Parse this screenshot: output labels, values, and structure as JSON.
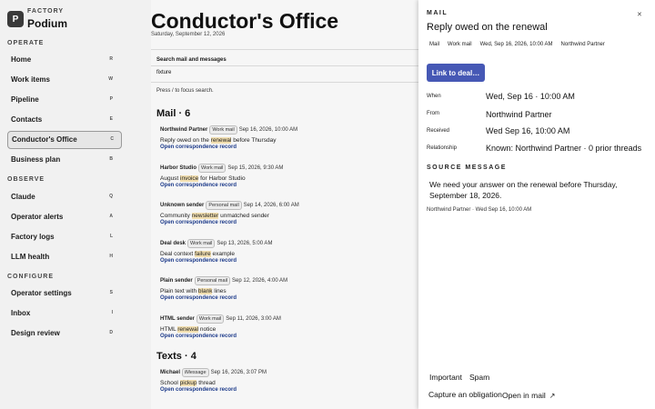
{
  "brand": {
    "logo_letter": "P",
    "kicker": "FACTORY",
    "name": "Podium"
  },
  "sidebar": {
    "sections": {
      "operate": "OPERATE",
      "observe": "OBSERVE",
      "configure": "CONFIGURE"
    },
    "items": [
      {
        "label": "Home",
        "key": "R"
      },
      {
        "label": "Work items",
        "key": "W"
      },
      {
        "label": "Pipeline",
        "key": "P"
      },
      {
        "label": "Contacts",
        "key": "E"
      },
      {
        "label": "Conductor's Office",
        "key": "C"
      },
      {
        "label": "Business plan",
        "key": "B"
      },
      {
        "label": "Claude",
        "key": "Q"
      },
      {
        "label": "Operator alerts",
        "key": "A"
      },
      {
        "label": "Factory logs",
        "key": "L"
      },
      {
        "label": "LLM health",
        "key": "H"
      },
      {
        "label": "Operator settings",
        "key": "S"
      },
      {
        "label": "Inbox",
        "key": "I"
      },
      {
        "label": "Design review",
        "key": "D"
      }
    ]
  },
  "main": {
    "title": "Conductor's Office",
    "date": "Saturday, September 12, 2026",
    "search_title": "Search mail and messages",
    "search_value": "fixture",
    "search_hint": "Press / to focus search.",
    "mail_heading": "Mail · 6",
    "texts_heading": "Texts · 4",
    "open_link": "Open correspondence record",
    "messages": [
      {
        "sender": "Northwind Partner",
        "pill": "Work mail",
        "meta": "Sep 16, 2026, 10:00 AM",
        "pre": "Reply owed on the ",
        "hl": "renewal",
        "post": " before Thursday"
      },
      {
        "sender": "Harbor Studio",
        "pill": "Work mail",
        "meta": "Sep 15, 2026, 9:30 AM",
        "pre": "August ",
        "hl": "invoice",
        "post": " for Harbor Studio"
      },
      {
        "sender": "Unknown sender",
        "pill": "Personal mail",
        "meta": "Sep 14, 2026, 6:00 AM",
        "pre": "Community ",
        "hl": "newsletter",
        "post": " unmatched sender"
      },
      {
        "sender": "Deal desk",
        "pill": "Work mail",
        "meta": "Sep 13, 2026, 5:00 AM",
        "pre": "Deal context ",
        "hl": "failure",
        "post": " example"
      },
      {
        "sender": "Plain sender",
        "pill": "Personal mail",
        "meta": "Sep 12, 2026, 4:00 AM",
        "pre": "Plain text with ",
        "hl": "blank",
        "post": " lines"
      },
      {
        "sender": "HTML sender",
        "pill": "Work mail",
        "meta": "Sep 11, 2026, 3:00 AM",
        "pre": "HTML ",
        "hl": "renewal",
        "post": " notice"
      }
    ],
    "texts": [
      {
        "sender": "Michael",
        "pill": "iMessage",
        "meta": "Sep 16, 2026, 3:07 PM",
        "pre": "School ",
        "hl": "pickup",
        "post": " thread"
      }
    ]
  },
  "panel": {
    "kicker": "MAIL",
    "close": "✕",
    "title": "Reply owed on the renewal",
    "tabs": [
      "Mail",
      "Work mail",
      "Wed, Sep 16, 2026, 10:00 AM",
      "Northwind Partner"
    ],
    "link_button": "Link to deal…",
    "fields": [
      {
        "label": "When",
        "value": "Wed, Sep 16 · 10:00 AM"
      },
      {
        "label": "From",
        "value": "Northwind Partner"
      },
      {
        "label": "Received",
        "value": "Wed Sep 16, 10:00 AM"
      },
      {
        "label": "Relationship",
        "value": "Known: Northwind Partner · 0 prior threads"
      }
    ],
    "source_kicker": "SOURCE MESSAGE",
    "source_text": "We need your answer on the renewal before Thursday, September 18, 2026.",
    "source_meta": "Northwind Partner · Wed Sep 16, 10:00 AM",
    "actions": {
      "important": "Important",
      "spam": "Spam",
      "capture": "Capture an obligation",
      "open_mail": "Open in mail",
      "open_icon": "↗"
    }
  }
}
